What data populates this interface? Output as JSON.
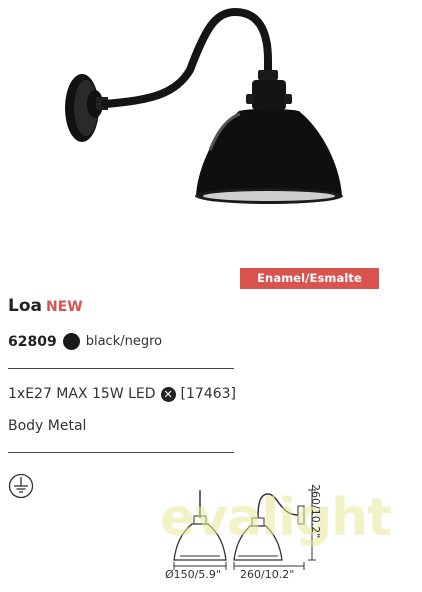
{
  "badge": "Enamel/Esmalte",
  "product": {
    "name": "Loa",
    "tag": "NEW"
  },
  "variant": {
    "code": "62809",
    "color_label": "black/negro",
    "swatch_color": "#1a1a1a"
  },
  "spec": {
    "lamp": "1xE27 MAX 15W LED",
    "excluded_icon": "x-icon",
    "bulb_ref": "[17463]"
  },
  "body": "Body Metal",
  "dimensions": {
    "diameter": "Ø150/5.9\"",
    "depth": "260/10.2\"",
    "height": "260/10.2\""
  },
  "icons": {
    "ground": "ground-icon"
  },
  "watermark": "evalight"
}
